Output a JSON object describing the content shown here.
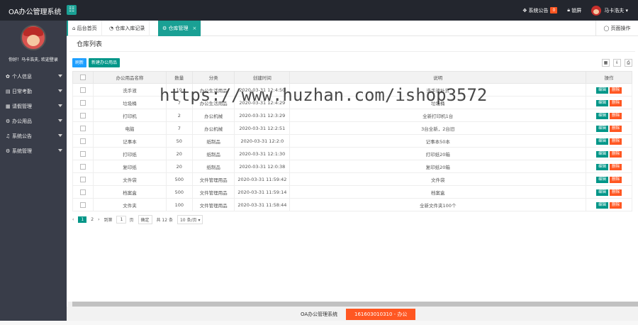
{
  "app": {
    "title": "OA办公管理系统"
  },
  "topbar": {
    "notice_label": "系统公告",
    "notice_count": "0",
    "lock_label": "锁屏",
    "user_name": "马卡浩夫"
  },
  "sidebar": {
    "welcome": "你好！马卡浩夫, 欢迎登录",
    "items": [
      {
        "label": "个人信息"
      },
      {
        "label": "日常考勤"
      },
      {
        "label": "请假管理"
      },
      {
        "label": "办公用品"
      },
      {
        "label": "系统公告"
      },
      {
        "label": "系统管理"
      }
    ]
  },
  "tabs": [
    {
      "label": "后台首页"
    },
    {
      "label": "仓库入库记录"
    },
    {
      "label": "仓库管理"
    }
  ],
  "page_op_label": "页面操作",
  "page_title": "仓库列表",
  "toolbar": {
    "refresh": "刷新",
    "new_item": "新建办公用品"
  },
  "table": {
    "headers": [
      "办公用品名称",
      "数量",
      "分类",
      "创建时间",
      "说明",
      "操作"
    ],
    "rows": [
      {
        "name": "洗手液",
        "qty": "19",
        "cat": "办公生活用品",
        "time": "2020-03-31 12:4:50",
        "desc": "洗手液补货",
        "edit": "编辑",
        "del": "删除"
      },
      {
        "name": "垃圾桶",
        "qty": "7",
        "cat": "办公生活用品",
        "time": "2020-03-31 12:4:29",
        "desc": "垃圾桶",
        "edit": "编辑",
        "del": "删除"
      },
      {
        "name": "打印机",
        "qty": "2",
        "cat": "办公机械",
        "time": "2020-03-31 12:3:29",
        "desc": "全新打印机1台",
        "edit": "编辑",
        "del": "删除"
      },
      {
        "name": "电脑",
        "qty": "7",
        "cat": "办公机械",
        "time": "2020-03-31 12:2:51",
        "desc": "3台全新，2台旧",
        "edit": "编辑",
        "del": "删除"
      },
      {
        "name": "记事本",
        "qty": "50",
        "cat": "纸制品",
        "time": "2020-03-31 12:2:0",
        "desc": "记事本50本",
        "edit": "编辑",
        "del": "删除"
      },
      {
        "name": "打印纸",
        "qty": "20",
        "cat": "纸制品",
        "time": "2020-03-31 12:1:30",
        "desc": "打印纸20箱",
        "edit": "编辑",
        "del": "删除"
      },
      {
        "name": "复印纸",
        "qty": "20",
        "cat": "纸制品",
        "time": "2020-03-31 12:0:38",
        "desc": "复印纸20箱",
        "edit": "编辑",
        "del": "删除"
      },
      {
        "name": "文件袋",
        "qty": "500",
        "cat": "文件管理用品",
        "time": "2020-03-31 11:59:42",
        "desc": "文件袋",
        "edit": "编辑",
        "del": "删除"
      },
      {
        "name": "档案盒",
        "qty": "500",
        "cat": "文件管理用品",
        "time": "2020-03-31 11:59:14",
        "desc": "档案盒",
        "edit": "编辑",
        "del": "删除"
      },
      {
        "name": "文件夹",
        "qty": "100",
        "cat": "文件管理用品",
        "time": "2020-03-31 11:58:44",
        "desc": "全新文件夹100个",
        "edit": "编辑",
        "del": "删除"
      }
    ]
  },
  "pager": {
    "page1": "1",
    "page2": "2",
    "goto": "到第",
    "input": "1",
    "page_unit": "页",
    "confirm": "确定",
    "total": "共 12 条",
    "per_page": "10 条/页"
  },
  "footer": {
    "name": "OA办公管理系统",
    "id": "161603010310 - 办公"
  },
  "watermark": "https://www.huzhan.com/ishop3572"
}
